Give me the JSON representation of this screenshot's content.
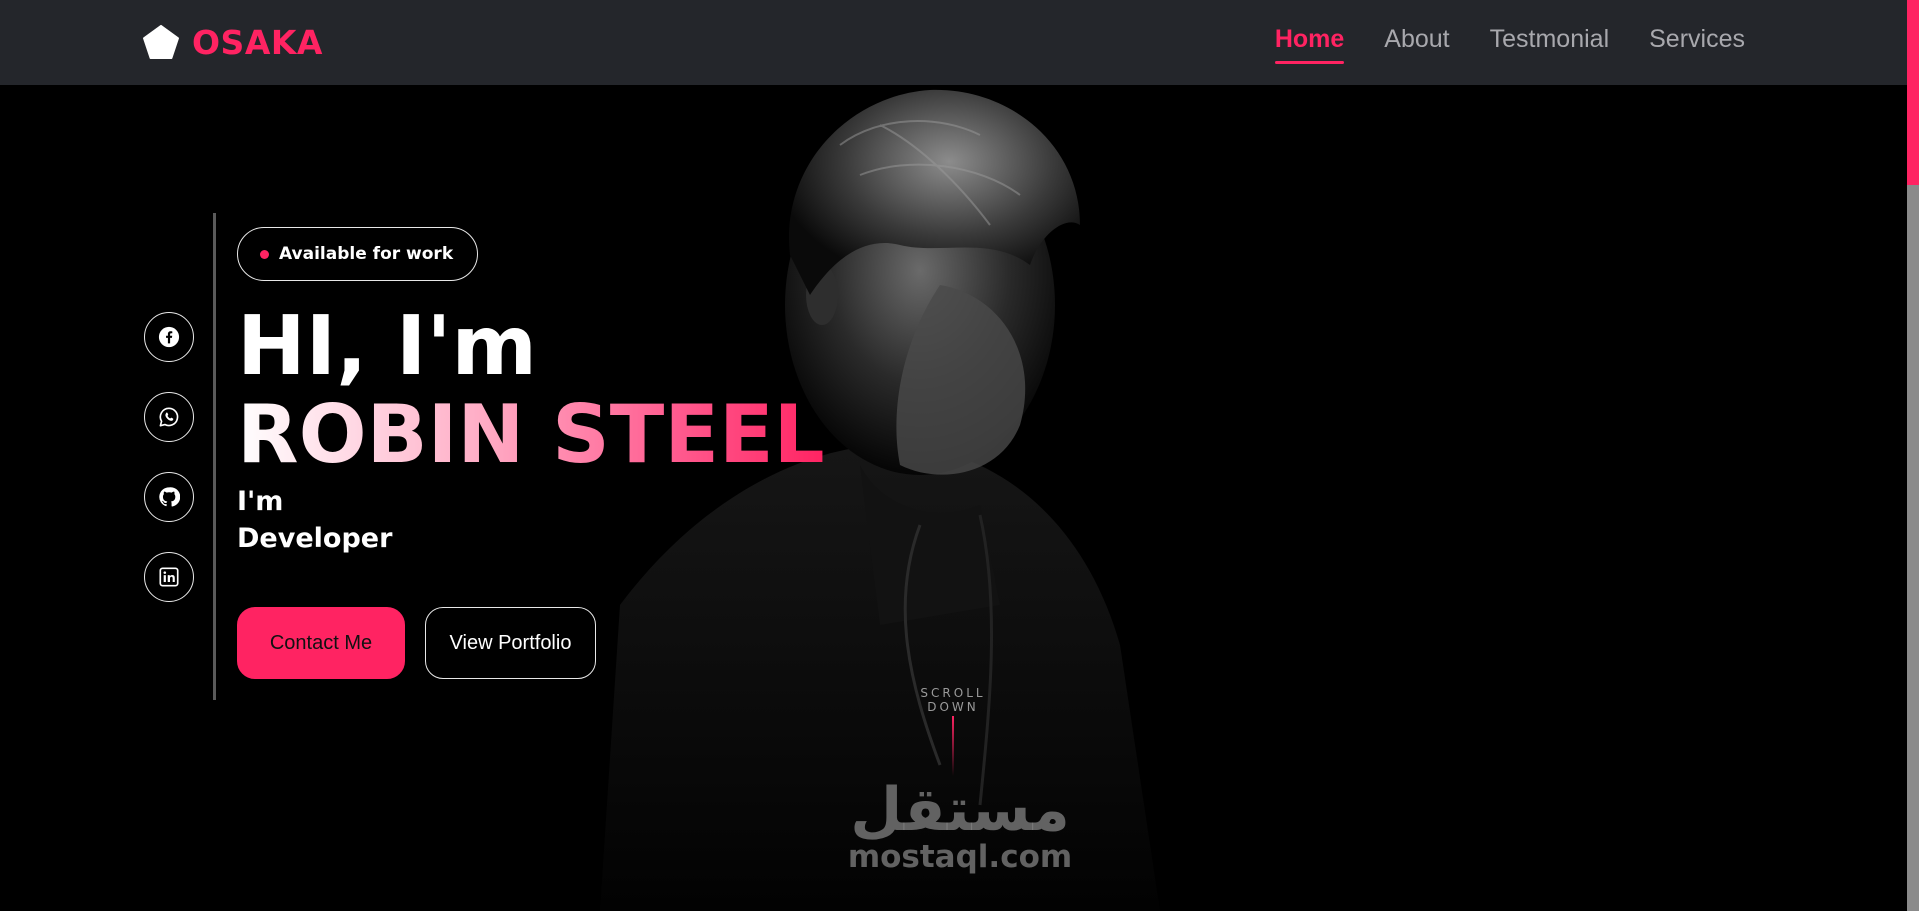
{
  "nav": {
    "brand": "OSAKA",
    "links": [
      {
        "label": "Home",
        "active": true
      },
      {
        "label": "About",
        "active": false
      },
      {
        "label": "Testmonial",
        "active": false
      },
      {
        "label": "Services",
        "active": false
      }
    ]
  },
  "hero": {
    "badge": "Available for work",
    "greeting": "HI, I'm",
    "name": "ROBIN STEEL",
    "role_prefix": "I'm",
    "role": "Developer",
    "primary_button": "Contact Me",
    "secondary_button": "View Portfolio",
    "scroll_hint": "SCROLL DOWN"
  },
  "social": [
    {
      "icon": "facebook-icon"
    },
    {
      "icon": "whatsapp-icon"
    },
    {
      "icon": "github-icon"
    },
    {
      "icon": "linkedin-icon"
    }
  ],
  "watermark": {
    "arabic": "مستقل",
    "latin": "mostaql.com"
  },
  "colors": {
    "accent": "#ff2362",
    "navbar_bg": "#24262b",
    "page_bg": "#000000",
    "nav_text": "#a8a8ad"
  }
}
